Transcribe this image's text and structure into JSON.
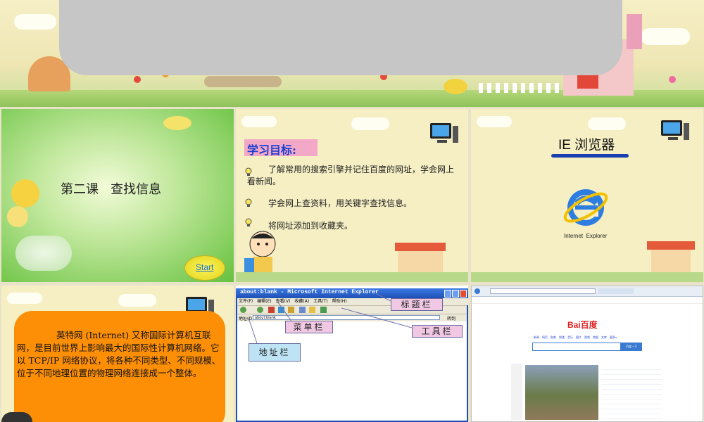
{
  "slide1": {
    "title": "第二课   查找信息",
    "start_label": "Start"
  },
  "slide2": {
    "heading": "学习目标:",
    "items": [
      "了解常用的搜索引擎并记住百度的网址，学会网上看新闻。",
      "学会网上查资料，用关键字查找信息。",
      "将网址添加到收藏夹。"
    ]
  },
  "slide3": {
    "title": "IE 浏览器",
    "logo_caption": "Internet  Explorer"
  },
  "slide4": {
    "paragraph": "英特网 (Internet) 又称国际计算机互联网，是目前世界上影响最大的国际性计算机网络。它以 TCP/IP 网络协议，将各种不同类型、不同规模、位于不同地理位置的物理网络连接成一个整体。"
  },
  "slide5": {
    "window_title": "about:blank - Microsoft Internet Explorer",
    "menu_items": [
      "文件(F)",
      "编辑(E)",
      "查看(V)",
      "收藏(A)",
      "工具(T)",
      "帮助(H)"
    ],
    "address_label": "地址(D)",
    "address_value": "about:blank",
    "go_label": "转到",
    "callouts": {
      "title_bar": "标题栏",
      "menu_bar": "菜单栏",
      "tool_bar": "工具栏",
      "address_bar": "地址栏"
    }
  },
  "slide6": {
    "brand": "Bai百度",
    "search_button": "百度一下",
    "nav_links": [
      "新闻",
      "网页",
      "贴吧",
      "知道",
      "音乐",
      "图片",
      "视频",
      "地图",
      "文库",
      "更多»"
    ]
  },
  "colors": {
    "accent_orange": "#fd8f06",
    "label_pink": "#f4a8c8",
    "ie_blue": "#1f4fb4"
  }
}
